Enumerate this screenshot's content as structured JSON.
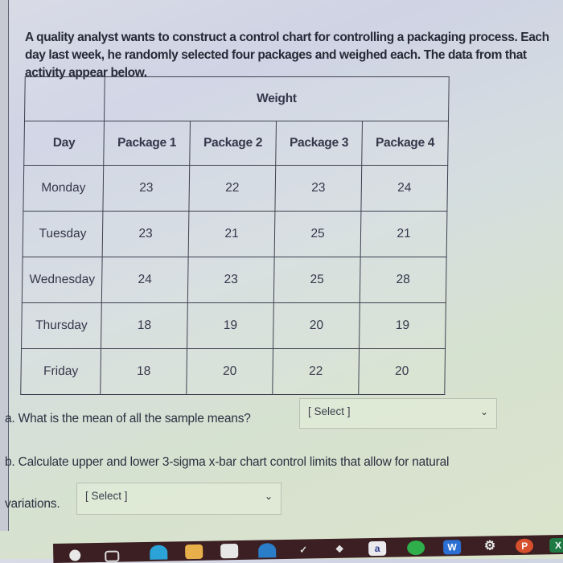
{
  "intro_text": "A quality analyst wants to construct a control chart for controlling a packaging process. Each day last week, he randomly selected four packages and weighed each. The data from that activity appear below.",
  "table": {
    "group_header": "Weight",
    "columns": [
      "Day",
      "Package 1",
      "Package 2",
      "Package 3",
      "Package 4"
    ],
    "rows": [
      {
        "day": "Monday",
        "values": [
          "23",
          "22",
          "23",
          "24"
        ]
      },
      {
        "day": "Tuesday",
        "values": [
          "23",
          "21",
          "25",
          "21"
        ]
      },
      {
        "day": "Wednesday",
        "values": [
          "24",
          "23",
          "25",
          "28"
        ]
      },
      {
        "day": "Thursday",
        "values": [
          "18",
          "19",
          "20",
          "19"
        ]
      },
      {
        "day": "Friday",
        "values": [
          "18",
          "20",
          "22",
          "20"
        ]
      }
    ]
  },
  "question_a": {
    "text": "a. What is the mean of all the sample means?",
    "select_value": "[ Select ]"
  },
  "question_b": {
    "text_line1": "b. Calculate upper and lower 3-sigma x-bar chart control limits that allow for natural",
    "text_line2": "variations.",
    "select_value": "[ Select ]"
  },
  "taskbar": {
    "icons": [
      "search-icon",
      "task-view-icon",
      "edge-icon",
      "file-explorer-icon",
      "store-icon",
      "mail-icon",
      "feather-icon",
      "dropbox-icon",
      "amazon-icon",
      "spotify-icon",
      "word-icon",
      "settings-icon",
      "powerpoint-icon",
      "excel-icon"
    ],
    "labels": {
      "amazon": "a",
      "word": "W",
      "powerpoint": "P",
      "excel": "X"
    }
  }
}
